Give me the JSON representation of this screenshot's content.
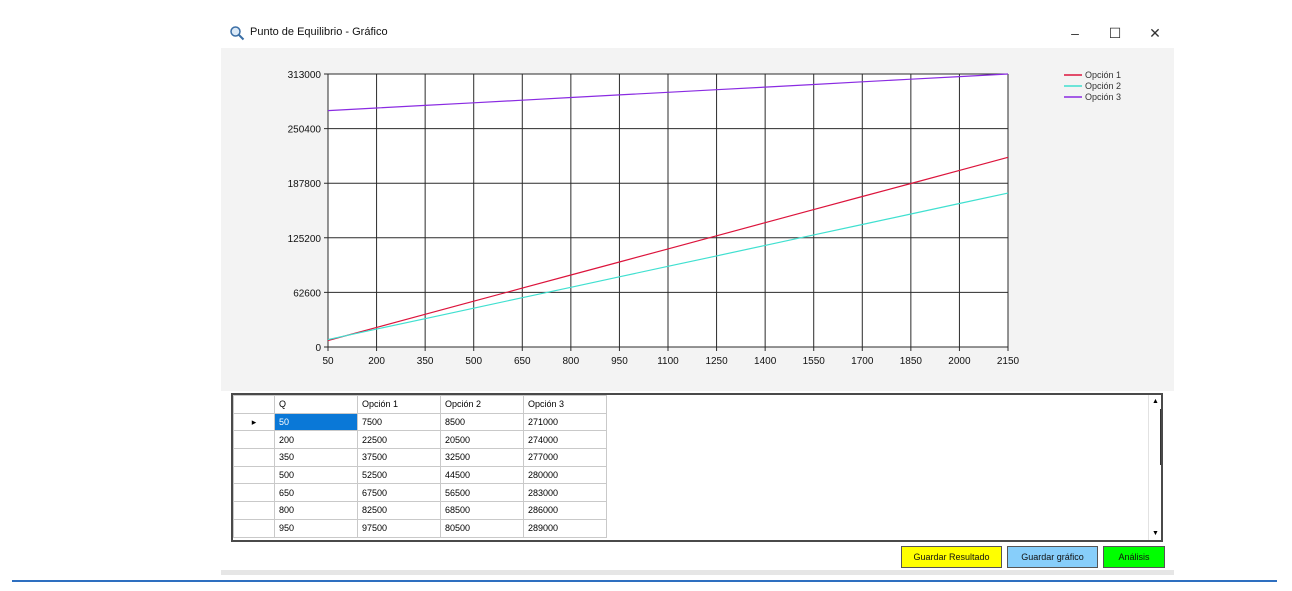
{
  "window": {
    "title": "Punto de Equilibrio - Gráfico",
    "minimize_glyph": "–",
    "maximize_glyph": "☐",
    "close_glyph": "✕"
  },
  "icons": {
    "title": "magnifier-icon"
  },
  "chart_data": {
    "type": "line",
    "x": [
      50,
      200,
      350,
      500,
      650,
      800,
      950,
      1100,
      1250,
      1400,
      1550,
      1700,
      1850,
      2000,
      2150
    ],
    "x_ticks": [
      "50",
      "200",
      "350",
      "500",
      "650",
      "800",
      "950",
      "1100",
      "1250",
      "1400",
      "1550",
      "1700",
      "1850",
      "2000",
      "2150"
    ],
    "y_ticks": [
      "0",
      "62600",
      "125200",
      "187800",
      "250400",
      "313000"
    ],
    "xlim": [
      50,
      2150
    ],
    "ylim": [
      0,
      313000
    ],
    "grid": true,
    "legend_position": "top-right",
    "series": [
      {
        "name": "Opción 1",
        "color": "#dc143c",
        "values": [
          7500,
          22500,
          37500,
          52500,
          67500,
          82500,
          97500,
          112500,
          127500,
          142500,
          157500,
          172500,
          187500,
          202500,
          217500
        ]
      },
      {
        "name": "Opción 2",
        "color": "#40e0d0",
        "values": [
          8500,
          20500,
          32500,
          44500,
          56500,
          68500,
          80500,
          92500,
          104500,
          116500,
          128500,
          140500,
          152500,
          164500,
          176500
        ]
      },
      {
        "name": "Opción 3",
        "color": "#8a2be2",
        "values": [
          271000,
          274000,
          277000,
          280000,
          283000,
          286000,
          289000,
          292000,
          295000,
          298000,
          301000,
          304000,
          307000,
          310000,
          313000
        ]
      }
    ]
  },
  "table": {
    "headers": [
      "Q",
      "Opción 1",
      "Opción 2",
      "Opción 3"
    ],
    "rows": [
      [
        "50",
        "7500",
        "8500",
        "271000"
      ],
      [
        "200",
        "22500",
        "20500",
        "274000"
      ],
      [
        "350",
        "37500",
        "32500",
        "277000"
      ],
      [
        "500",
        "52500",
        "44500",
        "280000"
      ],
      [
        "650",
        "67500",
        "56500",
        "283000"
      ],
      [
        "800",
        "82500",
        "68500",
        "286000"
      ],
      [
        "950",
        "97500",
        "80500",
        "289000"
      ]
    ],
    "current_row_marker": "▸"
  },
  "scrollbar": {
    "up": "▲",
    "down": "▼"
  },
  "buttons": {
    "save_result": "Guardar Resultado",
    "save_chart": "Guardar gráfico",
    "analysis": "Análisis"
  },
  "colors": {
    "save_result": "#ffff00",
    "save_chart": "#87cefa",
    "analysis": "#00ff00",
    "selection": "#0a78d7"
  }
}
